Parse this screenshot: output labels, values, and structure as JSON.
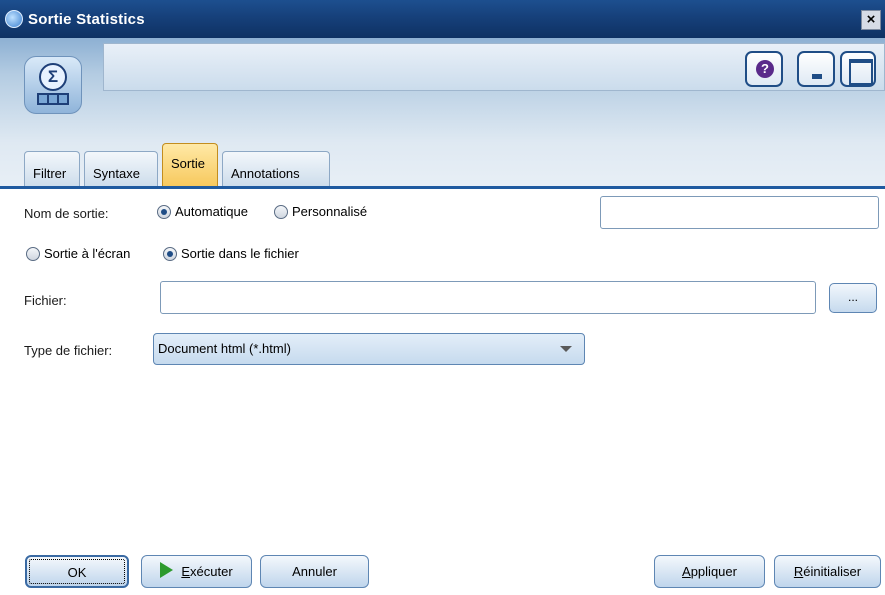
{
  "window": {
    "title": "Sortie Statistics",
    "close_glyph": "×"
  },
  "header": {
    "node_icon": "statistics-output-node-icon",
    "node_name": "",
    "help_glyph": "?"
  },
  "tabs": [
    {
      "label": "Filtrer",
      "active": false
    },
    {
      "label": "Syntaxe",
      "active": false
    },
    {
      "label": "Sortie",
      "active": true
    },
    {
      "label": "Annotations",
      "active": false
    }
  ],
  "form": {
    "output_name_label": "Nom de sortie:",
    "output_name_options": [
      {
        "label": "Automatique",
        "checked": true
      },
      {
        "label": "Personnalisé",
        "checked": false
      }
    ],
    "custom_name_value": "",
    "destination_options": [
      {
        "label": "Sortie à l'écran",
        "checked": false
      },
      {
        "label": "Sortie dans le fichier",
        "checked": true
      }
    ],
    "file_label": "Fichier:",
    "file_value": "",
    "browse_label": "...",
    "file_type_label": "Type de fichier:",
    "file_type_value": "Document html (*.html)"
  },
  "footer": {
    "ok": "OK",
    "run_prefix": "",
    "run_underlined": "E",
    "run_rest": "xécuter",
    "cancel": "Annuler",
    "apply_underlined": "A",
    "apply_rest": "ppliquer",
    "reset_underlined": "R",
    "reset_rest": "éinitialiser"
  }
}
